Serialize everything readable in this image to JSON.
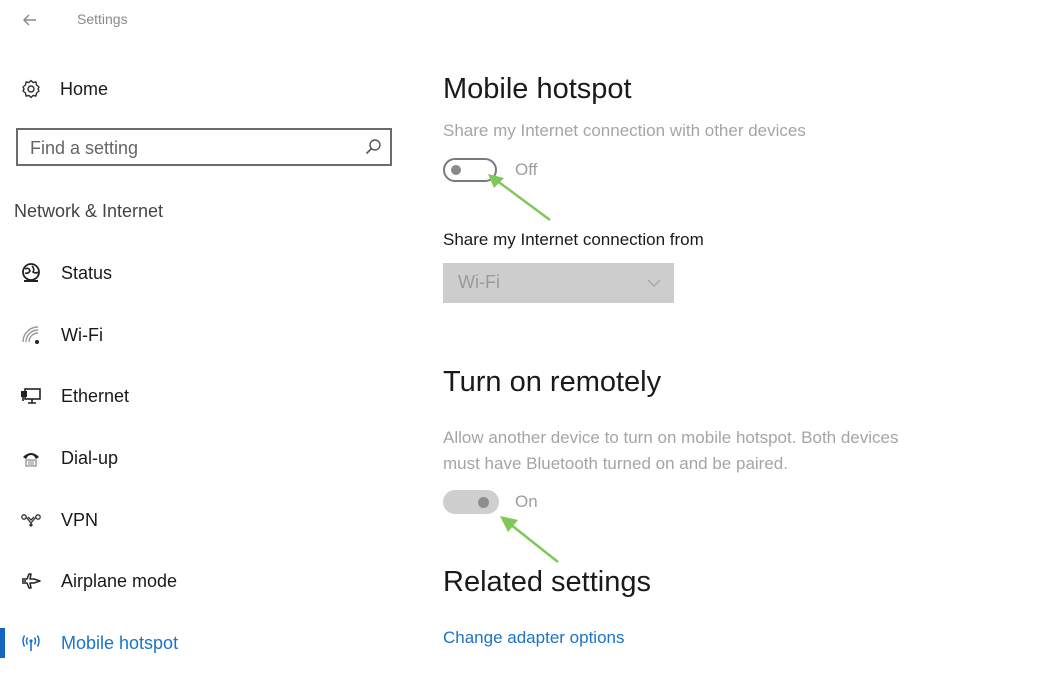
{
  "window": {
    "title": "Settings",
    "back_icon": "back-arrow-icon"
  },
  "sidebar": {
    "home": {
      "label": "Home",
      "icon": "gear-icon"
    },
    "search": {
      "placeholder": "Find a setting",
      "value": "",
      "icon": "search-icon"
    },
    "section_label": "Network & Internet",
    "items": [
      {
        "label": "Status",
        "icon": "globe-status-icon",
        "active": false
      },
      {
        "label": "Wi-Fi",
        "icon": "wifi-icon",
        "active": false
      },
      {
        "label": "Ethernet",
        "icon": "ethernet-icon",
        "active": false
      },
      {
        "label": "Dial-up",
        "icon": "dialup-phone-icon",
        "active": false
      },
      {
        "label": "VPN",
        "icon": "vpn-icon",
        "active": false
      },
      {
        "label": "Airplane mode",
        "icon": "airplane-icon",
        "active": false
      },
      {
        "label": "Mobile hotspot",
        "icon": "hotspot-antenna-icon",
        "active": true
      }
    ]
  },
  "main": {
    "hotspot": {
      "title": "Mobile hotspot",
      "description": "Share my Internet connection with other devices",
      "toggle_state": "Off",
      "toggle_on": false
    },
    "share_from": {
      "label": "Share my Internet connection from",
      "selected": "Wi-Fi",
      "disabled": true
    },
    "remote": {
      "title": "Turn on remotely",
      "description_line1": "Allow another device to turn on mobile hotspot. Both devices",
      "description_line2": "must have Bluetooth turned on and be paired.",
      "toggle_state": "On",
      "toggle_on": true,
      "disabled": true
    },
    "related": {
      "title": "Related settings",
      "links": [
        "Change adapter options"
      ]
    }
  },
  "annotations": {
    "arrow_color": "#7dc856",
    "accent_color": "#1a73c8"
  }
}
